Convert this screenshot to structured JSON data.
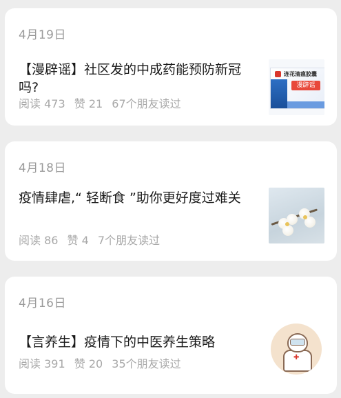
{
  "articles": [
    {
      "date": "4月19日",
      "title": "【漫辟谣】社区发的中成药能预防新冠吗?",
      "reads": "阅读 473",
      "likes": "赞 21",
      "friends": "67个朋友读过",
      "thumb": {
        "type": "medicine-box-image",
        "brand_text": "连花清瘟胶囊",
        "tag_text": "漫辟谣"
      }
    },
    {
      "date": "4月18日",
      "title": "疫情肆虐,“ 轻断食 ”助你更好度过难关",
      "reads": "阅读 86",
      "likes": "赞 4",
      "friends": "7个朋友读过",
      "thumb": {
        "type": "blossom-image"
      }
    },
    {
      "date": "4月16日",
      "title": "【言养生】疫情下的中医养生策略",
      "reads": "阅读 391",
      "likes": "赞 20",
      "friends": "35个朋友读过",
      "thumb": {
        "type": "doctor-illustration"
      }
    }
  ]
}
